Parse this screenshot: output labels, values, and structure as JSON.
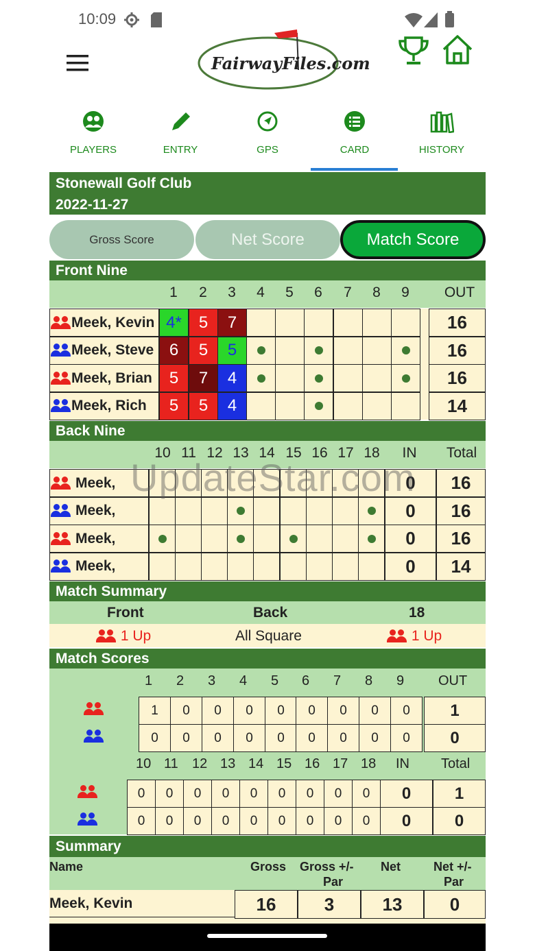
{
  "status": {
    "time": "10:09"
  },
  "logo": {
    "text": "FairwayFiles.com"
  },
  "tabs": [
    {
      "label": "PLAYERS",
      "icon": "players-icon"
    },
    {
      "label": "ENTRY",
      "icon": "pencil-icon"
    },
    {
      "label": "GPS",
      "icon": "gps-icon"
    },
    {
      "label": "CARD",
      "icon": "card-list-icon"
    },
    {
      "label": "HISTORY",
      "icon": "history-books-icon"
    }
  ],
  "course": {
    "name": "Stonewall Golf Club",
    "date": "2022-11-27"
  },
  "score_buttons": {
    "gross": "Gross Score",
    "net": "Net Score",
    "match": "Match Score"
  },
  "front_nine": {
    "title": "Front Nine",
    "holes": [
      "1",
      "2",
      "3",
      "4",
      "5",
      "6",
      "7",
      "8",
      "9"
    ],
    "out_label": "OUT",
    "players": [
      {
        "name": "Meek, Kevin",
        "team": "red",
        "scores": [
          "4*",
          "5",
          "7"
        ],
        "out": "16"
      },
      {
        "name": "Meek, Steve",
        "team": "blue",
        "scores": [
          "6",
          "5",
          "5"
        ],
        "out": "16"
      },
      {
        "name": "Meek, Brian",
        "team": "red",
        "scores": [
          "5",
          "7",
          "4"
        ],
        "out": "16"
      },
      {
        "name": "Meek, Rich",
        "team": "blue",
        "scores": [
          "5",
          "5",
          "4"
        ],
        "out": "14"
      }
    ]
  },
  "back_nine": {
    "title": "Back Nine",
    "holes": [
      "10",
      "11",
      "12",
      "13",
      "14",
      "15",
      "16",
      "17",
      "18"
    ],
    "in_label": "IN",
    "total_label": "Total",
    "players": [
      {
        "name": "Meek,",
        "team": "red",
        "in": "0",
        "total": "16"
      },
      {
        "name": "Meek,",
        "team": "blue",
        "in": "0",
        "total": "16"
      },
      {
        "name": "Meek,",
        "team": "red",
        "in": "0",
        "total": "16"
      },
      {
        "name": "Meek,",
        "team": "blue",
        "in": "0",
        "total": "14"
      }
    ]
  },
  "match_summary": {
    "title": "Match Summary",
    "front_label": "Front",
    "back_label": "Back",
    "eighteen_label": "18",
    "front_value": "1 Up",
    "back_value": "All Square",
    "eighteen_value": "1 Up"
  },
  "match_scores": {
    "title": "Match Scores",
    "front_holes": [
      "1",
      "2",
      "3",
      "4",
      "5",
      "6",
      "7",
      "8",
      "9"
    ],
    "out_label": "OUT",
    "front_rows": [
      {
        "team": "red",
        "values": [
          "1",
          "0",
          "0",
          "0",
          "0",
          "0",
          "0",
          "0",
          "0"
        ],
        "total": "1"
      },
      {
        "team": "blue",
        "values": [
          "0",
          "0",
          "0",
          "0",
          "0",
          "0",
          "0",
          "0",
          "0"
        ],
        "total": "0"
      }
    ],
    "back_holes": [
      "10",
      "11",
      "12",
      "13",
      "14",
      "15",
      "16",
      "17",
      "18"
    ],
    "in_label": "IN",
    "total_label": "Total",
    "back_rows": [
      {
        "team": "red",
        "values": [
          "0",
          "0",
          "0",
          "0",
          "0",
          "0",
          "0",
          "0",
          "0"
        ],
        "in": "0",
        "total": "1"
      },
      {
        "team": "blue",
        "values": [
          "0",
          "0",
          "0",
          "0",
          "0",
          "0",
          "0",
          "0",
          "0"
        ],
        "in": "0",
        "total": "0"
      }
    ]
  },
  "summary": {
    "title": "Summary",
    "headers": {
      "name": "Name",
      "gross": "Gross",
      "gross_par": "Gross +/-",
      "gross_par2": "Par",
      "net": "Net",
      "net_par": "Net +/-",
      "net_par2": "Par"
    },
    "rows": [
      {
        "name": "Meek, Kevin",
        "gross": "16",
        "gross_par": "3",
        "net": "13",
        "net_par": "0"
      }
    ]
  },
  "watermark": "UpdateStar.com",
  "colors": {
    "red_team": "#e8231e",
    "blue_team": "#1a2fe0",
    "dark_green": "#3e7b32",
    "light_green": "#b6dfad",
    "cream": "#fdf4d2",
    "accent_green": "#0aa83a"
  }
}
